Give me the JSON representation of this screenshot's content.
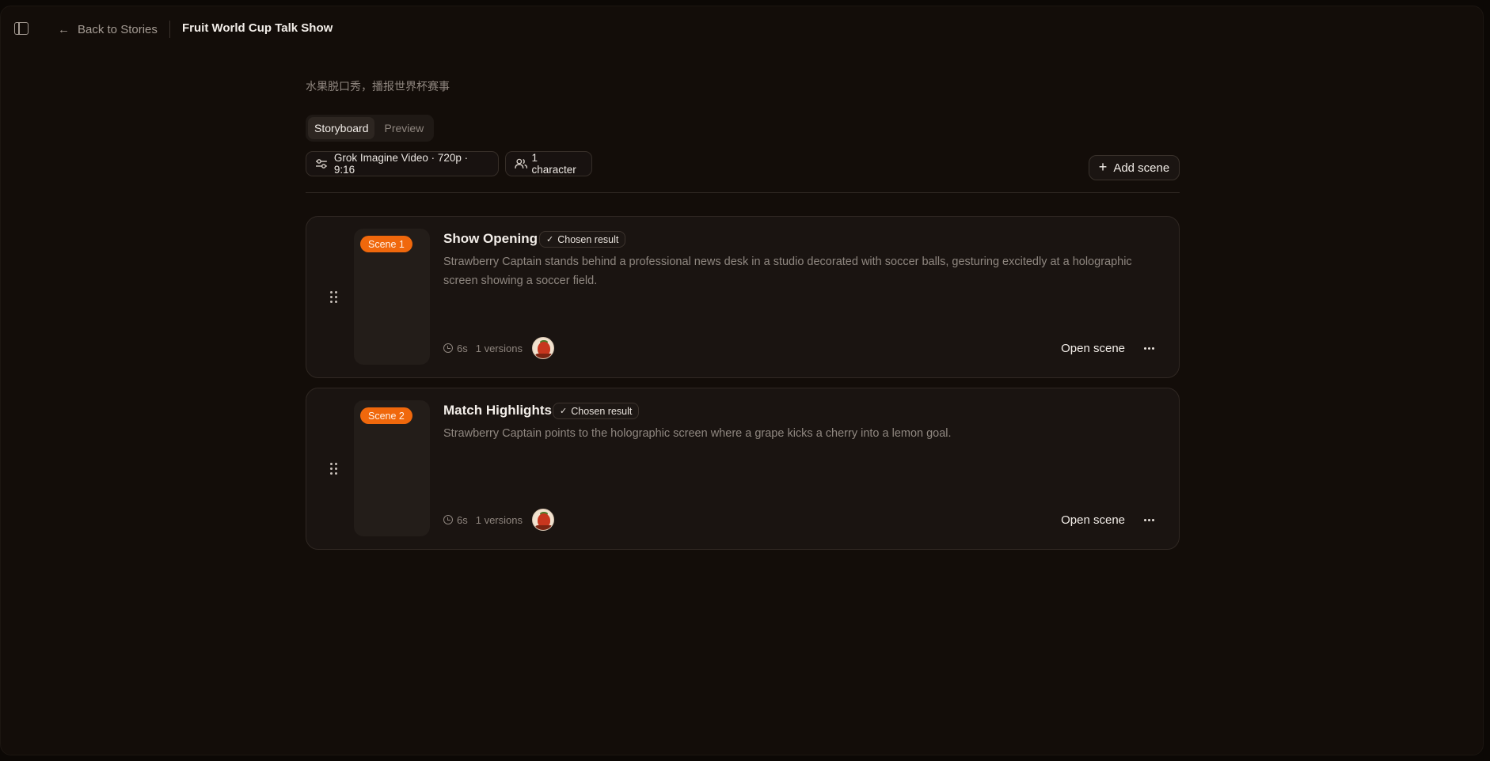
{
  "header": {
    "back_label": "Back to Stories",
    "story_title": "Fruit World Cup Talk Show"
  },
  "story": {
    "description": "水果脱口秀，播报世界杯赛事",
    "tabs": [
      {
        "label": "Storyboard",
        "active": true
      },
      {
        "label": "Preview",
        "active": false
      }
    ],
    "settings": {
      "model_label": "Grok Imagine Video · 720p · 9:16",
      "characters_label": "1 character"
    },
    "add_scene_label": "Add scene"
  },
  "scenes": [
    {
      "badge": "Scene 1",
      "title": "Show Opening",
      "chosen_label": "Chosen result",
      "description": "Strawberry Captain stands behind a professional news desk in a studio decorated with soccer balls, gesturing excitedly at a holographic screen showing a soccer field.",
      "duration": "6s",
      "versions": "1 versions",
      "open_label": "Open scene"
    },
    {
      "badge": "Scene 2",
      "title": "Match Highlights",
      "chosen_label": "Chosen result",
      "description": "Strawberry Captain points to the holographic screen where a grape kicks a cherry into a lemon goal.",
      "duration": "6s",
      "versions": "1 versions",
      "open_label": "Open scene"
    }
  ],
  "colors": {
    "accent": "#f0680c",
    "background": "#130d09",
    "card": "#1a1411"
  }
}
